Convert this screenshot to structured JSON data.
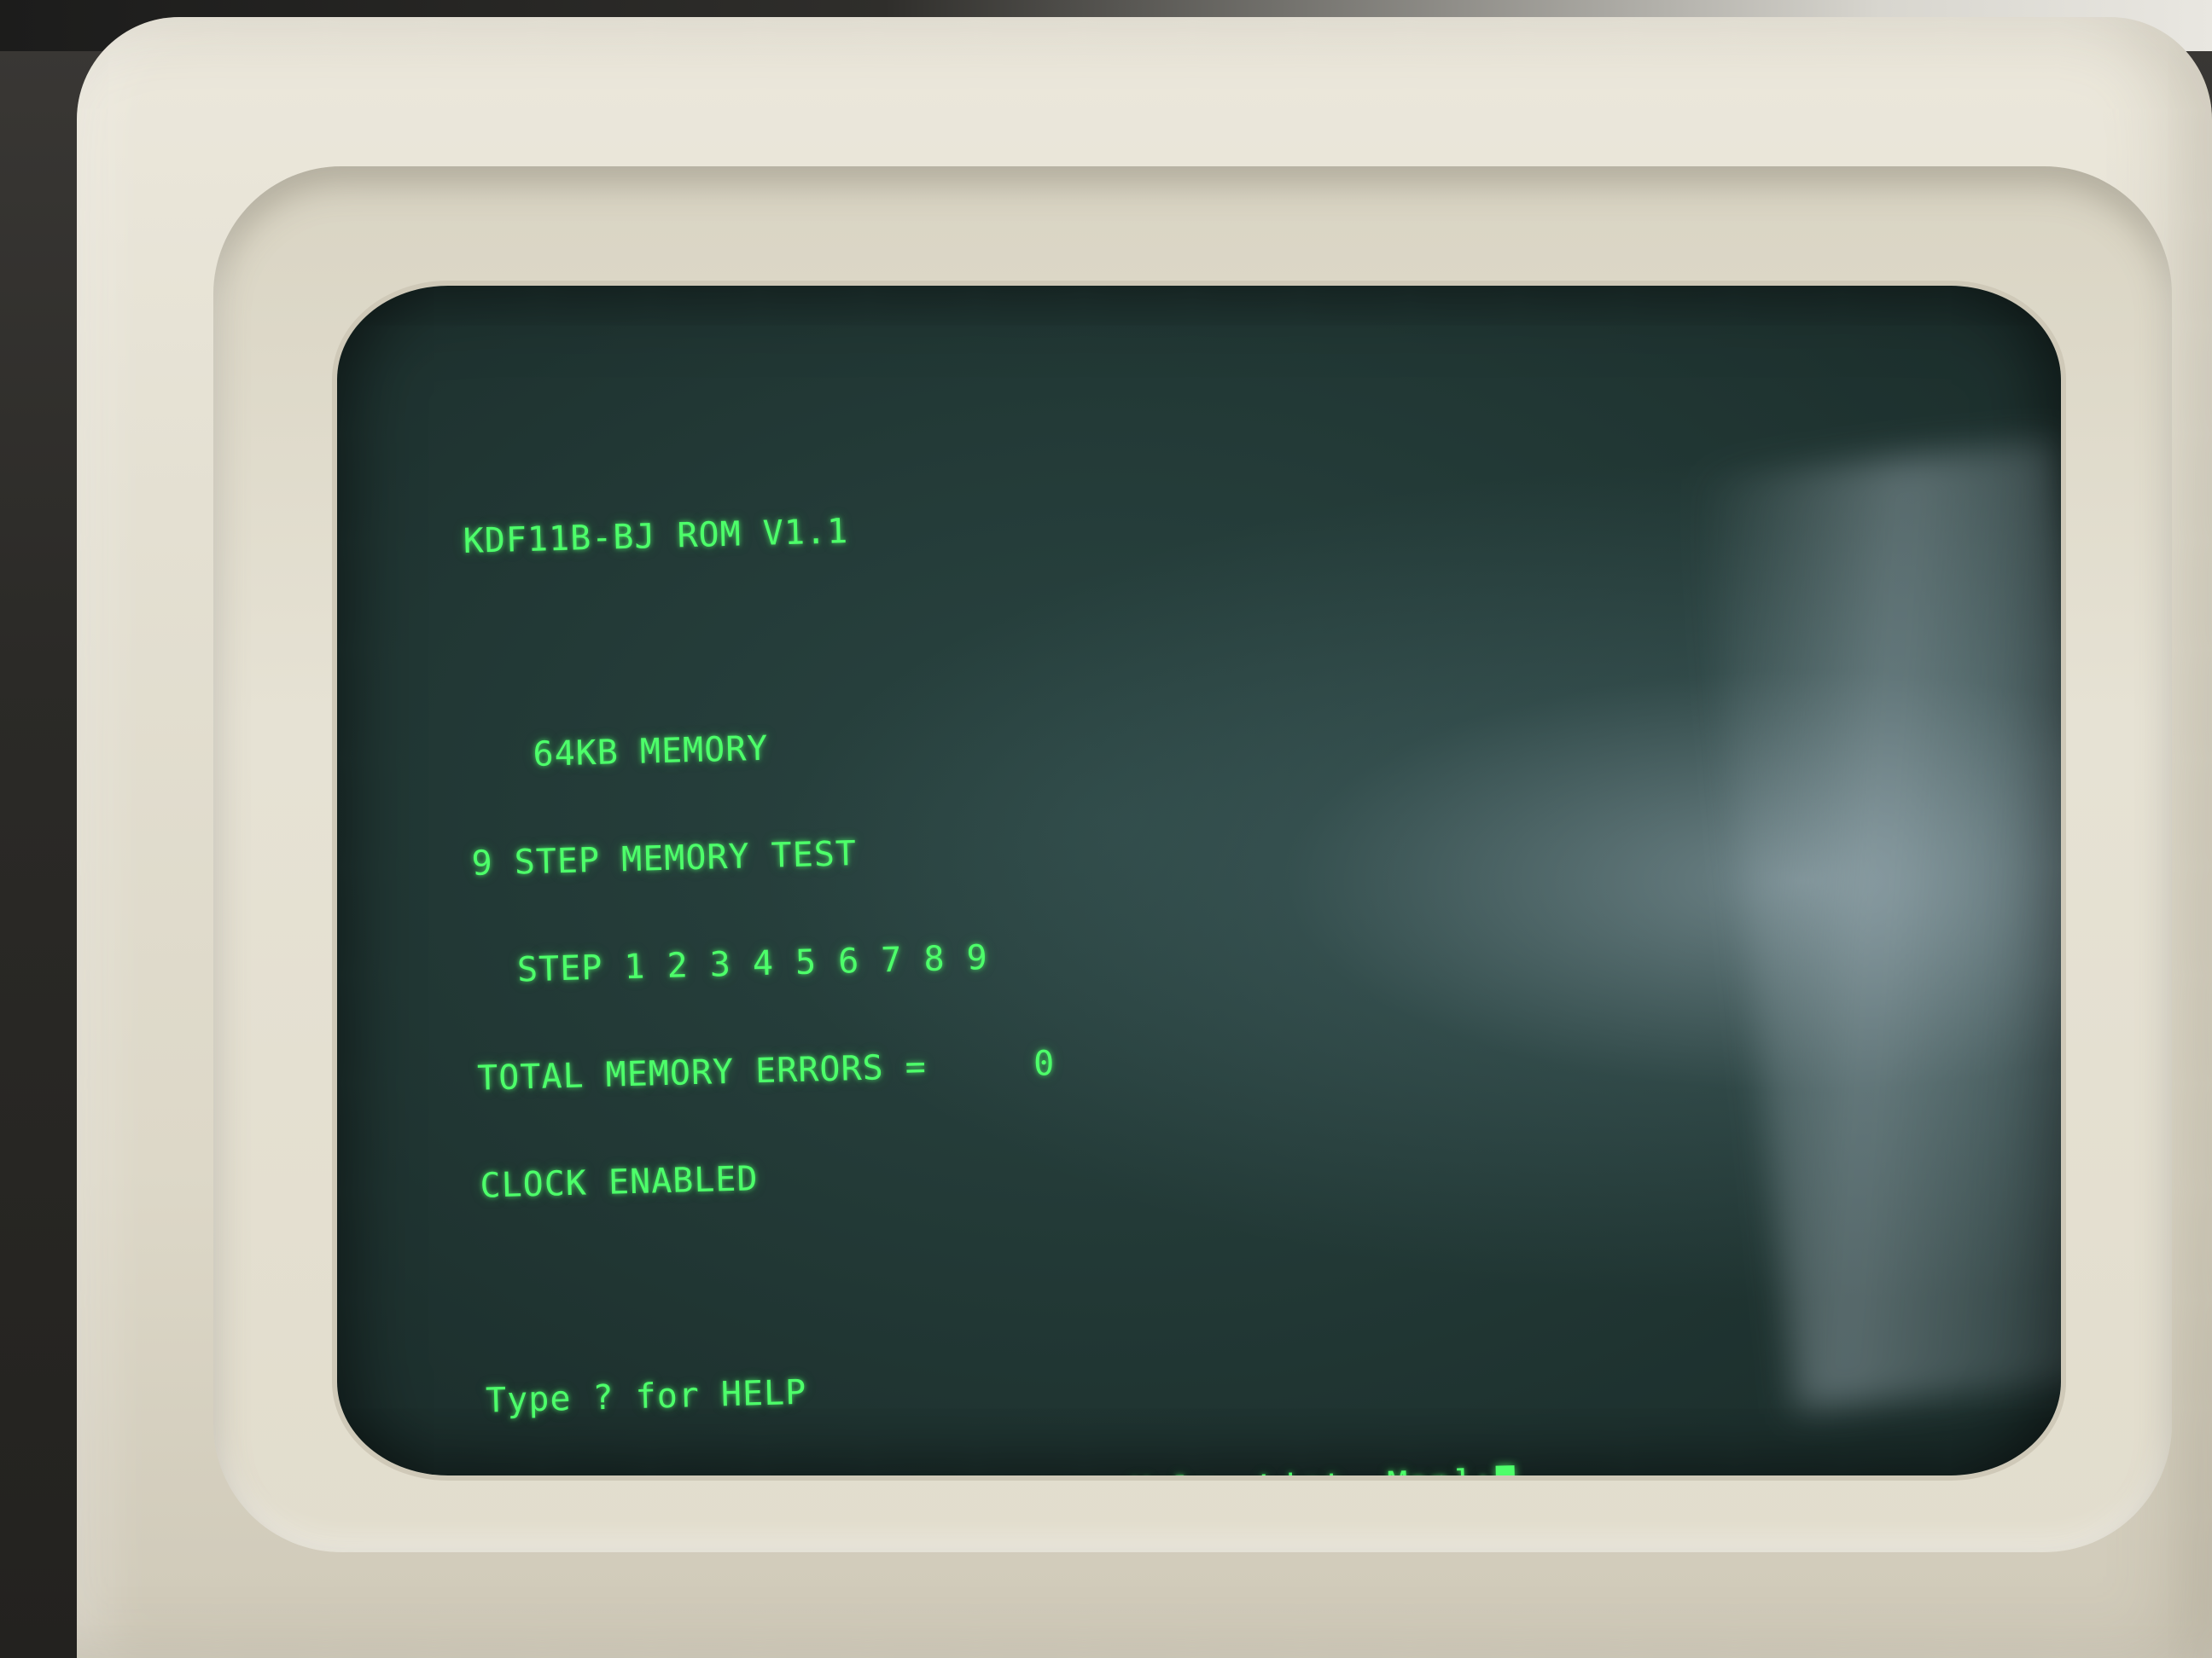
{
  "screen": {
    "rom_header": "KDF11B-BJ ROM V1.1",
    "memory_size": "   64KB MEMORY",
    "memory_test_title": "9 STEP MEMORY TEST",
    "memory_test_steps": "  STEP 1 2 3 4 5 6 7 8 9",
    "memory_errors": "TOTAL MEMORY ERRORS =     0",
    "clock_status": "CLOCK ENABLED",
    "help_hint": "Type ? for HELP",
    "prompt": "Enter one of [Boot, Diagnose, Help, List, Map]:"
  },
  "colors": {
    "phosphor": "#4dff6a",
    "crt_background": "#213734",
    "bezel": "#e4e0d2"
  }
}
